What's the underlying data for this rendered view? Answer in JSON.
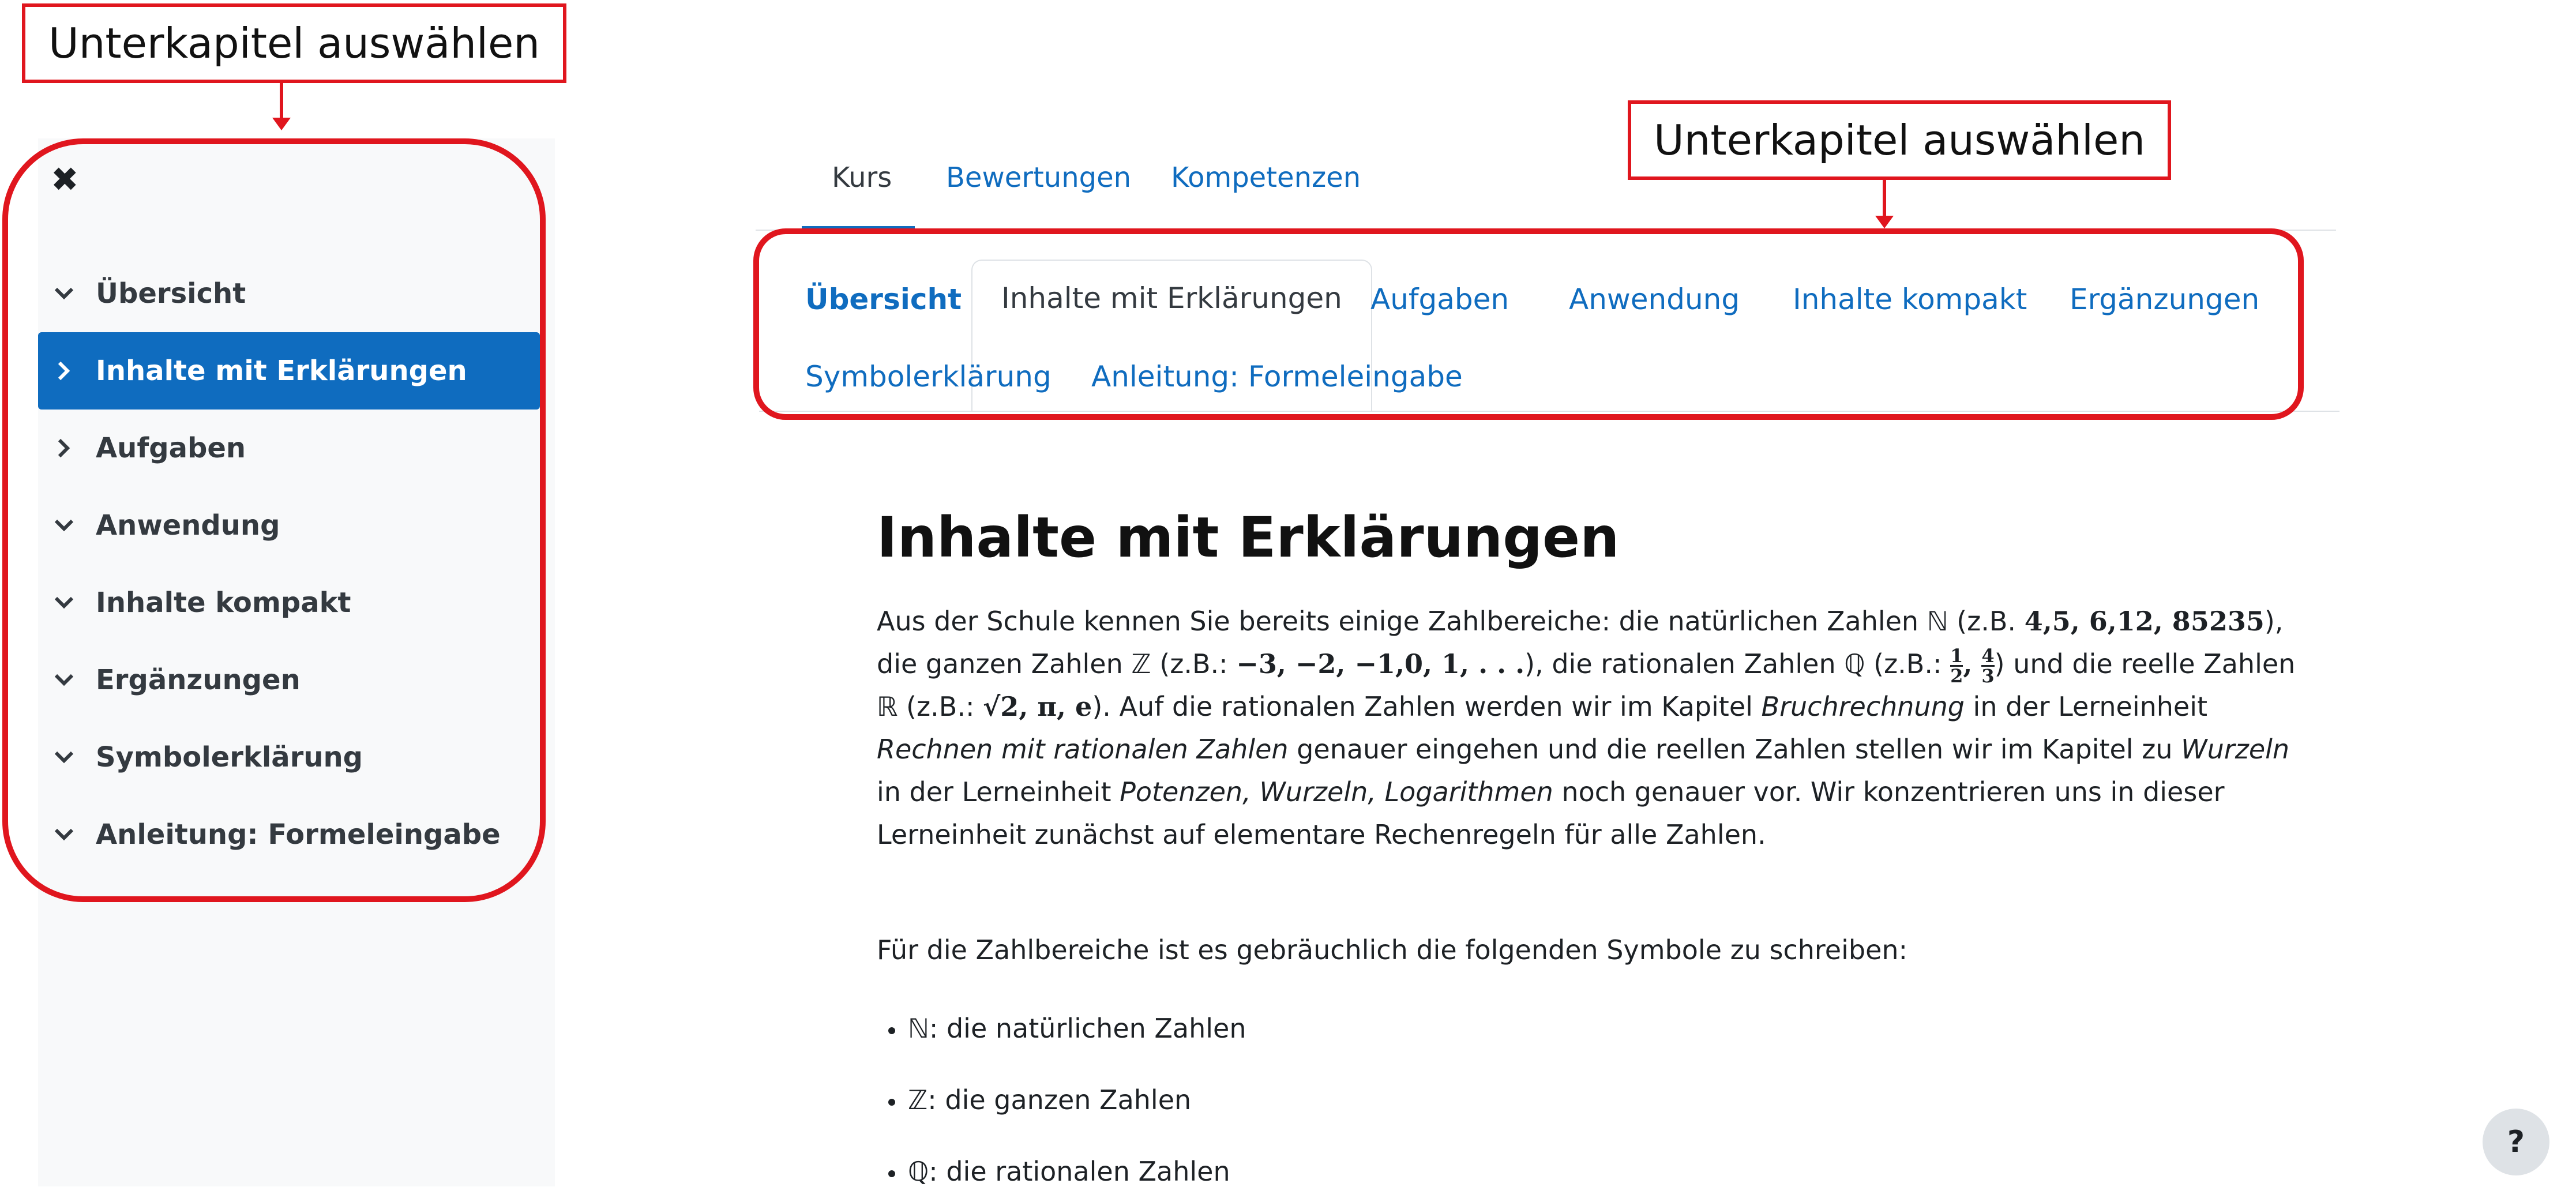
{
  "annotation": {
    "left_label": "Unterkapitel auswählen",
    "top_label": "Unterkapitel auswählen"
  },
  "sidebar": {
    "close_icon": "✖",
    "items": [
      {
        "label": "Übersicht",
        "chevron": "down",
        "active": false
      },
      {
        "label": "Inhalte mit Erklärungen",
        "chevron": "right",
        "active": true
      },
      {
        "label": "Aufgaben",
        "chevron": "right",
        "active": false
      },
      {
        "label": "Anwendung",
        "chevron": "down",
        "active": false
      },
      {
        "label": "Inhalte kompakt",
        "chevron": "down",
        "active": false
      },
      {
        "label": "Ergänzungen",
        "chevron": "down",
        "active": false
      },
      {
        "label": "Symbolerklärung",
        "chevron": "down",
        "active": false
      },
      {
        "label": "Anleitung: Formeleingabe",
        "chevron": "down",
        "active": false
      }
    ]
  },
  "topnav": {
    "tabs": [
      "Kurs",
      "Bewertungen",
      "Kompetenzen"
    ],
    "active": "Kurs"
  },
  "subtabs": {
    "items": [
      "Übersicht",
      "Inhalte mit Erklärungen",
      "Aufgaben",
      "Anwendung",
      "Inhalte kompakt",
      "Ergänzungen",
      "Symbolerklärung",
      "Anleitung: Formeleingabe"
    ],
    "active": "Inhalte mit Erklärungen"
  },
  "content": {
    "title": "Inhalte mit Erklärungen",
    "p1": {
      "t1": "Aus der Schule kennen Sie bereits einige Zahlbereiche: die natürlichen Zahlen ℕ (z.B. ",
      "m1": "4,5, 6,12, 85235",
      "t2": "), die ganzen Zahlen ℤ (z.B.: ",
      "m2": "−3, −2, −1,0, 1, . . .",
      "t3": "), die rationalen Zahlen ℚ (z.B.: ",
      "f1n": "1",
      "f1d": "2",
      "f2n": "4",
      "f2d": "3",
      "t4": ") und die reelle Zahlen ℝ (z.B.: ",
      "m3": "√2, π, e",
      "t5": "). Auf die rationalen Zahlen werden wir im Kapitel ",
      "i1": "Bruchrechnung",
      "t6": " in der Lerneinheit ",
      "i2": "Rechnen mit rationalen Zahlen",
      "t7": " genauer eingehen und die reellen Zahlen stellen wir im Kapitel zu ",
      "i3": "Wurzeln",
      "t8": " in der Lerneinheit ",
      "i4": "Potenzen, Wurzeln, Logarithmen",
      "t9": " noch genauer vor. Wir konzentrieren uns in dieser Lerneinheit zunächst auf elementare Rechenregeln für alle Zahlen."
    },
    "p2": "Für die Zahlbereiche ist es gebräuchlich die folgenden Symbole zu schreiben:",
    "list": [
      {
        "symbol": "ℕ",
        "text": ": die natürlichen Zahlen"
      },
      {
        "symbol": "ℤ",
        "text": ": die ganzen Zahlen"
      },
      {
        "symbol": "ℚ",
        "text": ": die rationalen Zahlen"
      }
    ]
  },
  "help": {
    "label": "?"
  }
}
